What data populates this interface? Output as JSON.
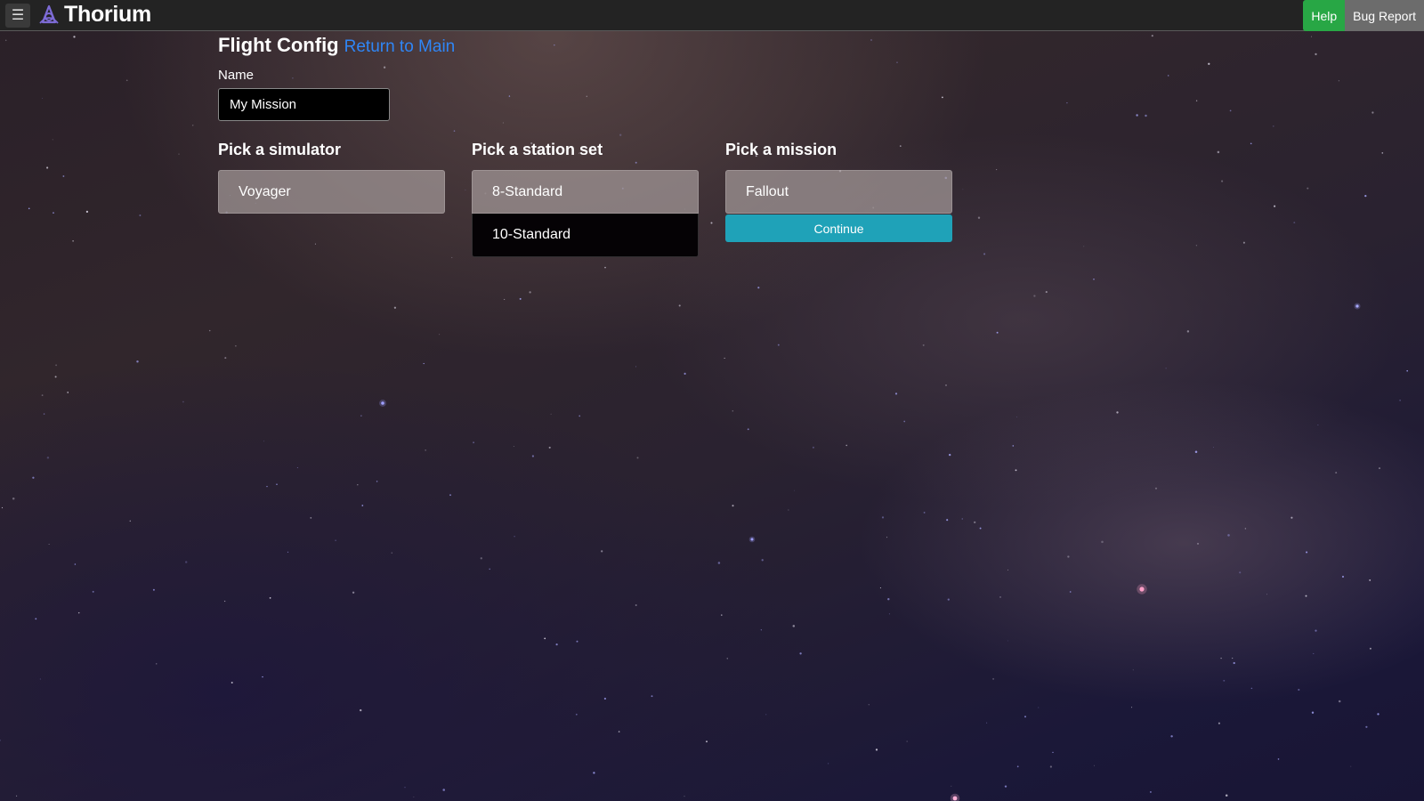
{
  "navbar": {
    "menu_icon": "hamburger-menu-icon",
    "brand_icon": "thorium-logo-icon",
    "brand_name": "Thorium",
    "help_label": "Help",
    "bug_report_label": "Bug Report",
    "colors": {
      "help": "#28a745",
      "bug_report": "#6c6c6c",
      "navbar_bg": "#232323"
    }
  },
  "header": {
    "title": "Flight Config",
    "return_link": "Return to Main"
  },
  "form": {
    "name_label": "Name",
    "name_value": "My Mission"
  },
  "simulator": {
    "heading": "Pick a simulator",
    "items": [
      {
        "label": "Voyager",
        "selected": true
      }
    ]
  },
  "station_set": {
    "heading": "Pick a station set",
    "items": [
      {
        "label": "8-Standard",
        "selected": true
      },
      {
        "label": "10-Standard",
        "selected": false
      }
    ]
  },
  "mission": {
    "heading": "Pick a mission",
    "items": [
      {
        "label": "Fallout",
        "selected": true
      }
    ],
    "continue_label": "Continue",
    "continue_color": "#1fa2b8"
  }
}
